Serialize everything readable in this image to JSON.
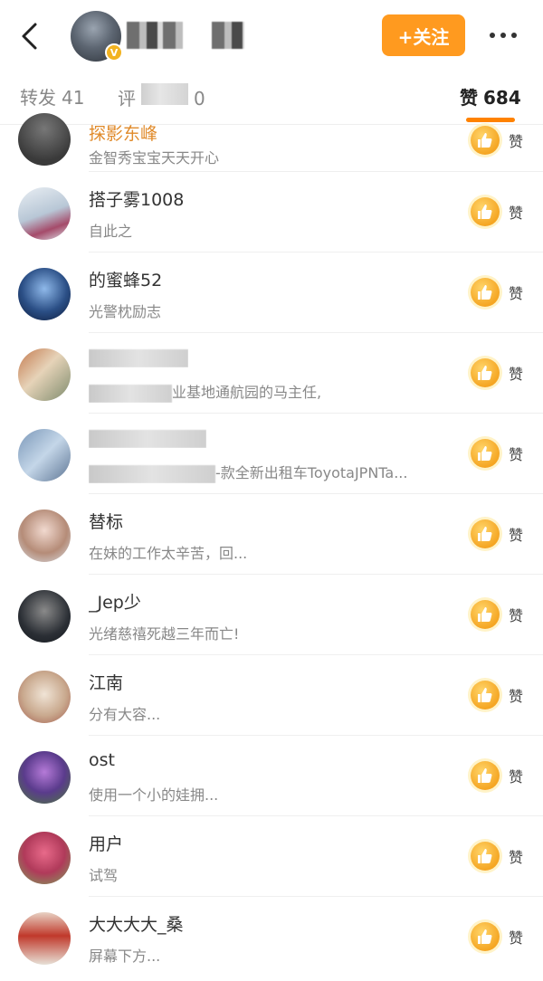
{
  "header": {
    "back_icon": "chevron-left-icon",
    "verified_badge": "V",
    "follow_label": "+关注",
    "more_icon": "more-dots-icon"
  },
  "tabs": [
    {
      "label": "转发",
      "count": "41"
    },
    {
      "label": "评",
      "count": "0"
    },
    {
      "label": "赞",
      "count": "684"
    }
  ],
  "colors": {
    "accent": "#ff8200",
    "follow_bg": "#ff9a1f",
    "like": "#f5a623",
    "verified": "#f2b321"
  },
  "likes": [
    {
      "name": "探影东峰",
      "desc": "金智秀宝宝天天开心",
      "like_label": "赞",
      "verified": true
    },
    {
      "name": "搭子雾1008",
      "desc": "自此之",
      "like_label": "赞"
    },
    {
      "name": "的蜜蜂52",
      "desc": "光警枕励志",
      "like_label": "赞"
    },
    {
      "name": "",
      "desc": "业基地通航园的马主任,",
      "like_label": "赞"
    },
    {
      "name": "",
      "desc": "-款全新出租车ToyotaJPNTa...",
      "like_label": "赞"
    },
    {
      "name": "替标",
      "desc": "在妹的工作太辛苦，回...",
      "like_label": "赞"
    },
    {
      "name": "_Jep少",
      "desc": "光绪慈禧死越三年而亡!",
      "like_label": "赞"
    },
    {
      "name": "江南",
      "desc": "分有大容...",
      "like_label": "赞"
    },
    {
      "name": "ost",
      "desc": "使用一个小的娃拥...",
      "like_label": "赞"
    },
    {
      "name": "用户",
      "desc": "试驾",
      "like_label": "赞"
    },
    {
      "name": "大大大大_桑",
      "desc": "屏幕下方...",
      "like_label": "赞"
    }
  ]
}
